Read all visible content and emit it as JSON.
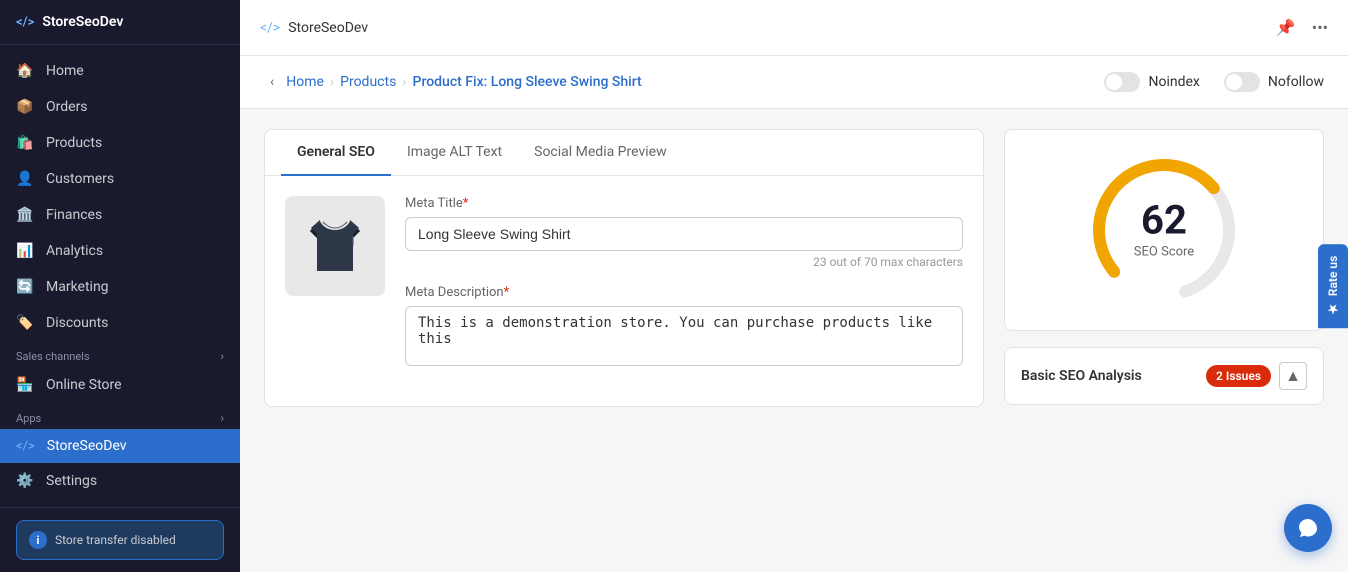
{
  "sidebar": {
    "app_name": "StoreSeoDev",
    "code_icon": "</>",
    "nav_items": [
      {
        "id": "home",
        "label": "Home",
        "icon": "🏠"
      },
      {
        "id": "orders",
        "label": "Orders",
        "icon": "📦"
      },
      {
        "id": "products",
        "label": "Products",
        "icon": "🛍️"
      },
      {
        "id": "customers",
        "label": "Customers",
        "icon": "👤"
      },
      {
        "id": "finances",
        "label": "Finances",
        "icon": "🏛️"
      },
      {
        "id": "analytics",
        "label": "Analytics",
        "icon": "📊"
      },
      {
        "id": "marketing",
        "label": "Marketing",
        "icon": "🔄"
      },
      {
        "id": "discounts",
        "label": "Discounts",
        "icon": "🏷️"
      }
    ],
    "sales_channels_label": "Sales channels",
    "online_store_label": "Online Store",
    "apps_label": "Apps",
    "active_app": "StoreSeoDev",
    "settings_label": "Settings",
    "store_transfer_label": "Store transfer disabled"
  },
  "topbar": {
    "app_name": "StoreSeoDev"
  },
  "breadcrumb": {
    "back_label": "‹",
    "home": "Home",
    "products": "Products",
    "current": "Product Fix: Long Sleeve Swing Shirt",
    "noindex_label": "Noindex",
    "nofollow_label": "Nofollow"
  },
  "tabs": [
    {
      "id": "general",
      "label": "General SEO",
      "active": true
    },
    {
      "id": "alt_text",
      "label": "Image ALT Text",
      "active": false
    },
    {
      "id": "social",
      "label": "Social Media Preview",
      "active": false
    }
  ],
  "form": {
    "meta_title_label": "Meta Title",
    "meta_title_required": "*",
    "meta_title_value": "Long Sleeve Swing Shirt",
    "meta_title_hint": "23 out of 70 max characters",
    "meta_description_label": "Meta Description",
    "meta_description_required": "*",
    "meta_description_value": "This is a demonstration store. You can purchase products like this"
  },
  "seo_score": {
    "score": "62",
    "label": "SEO Score",
    "circle_color": "#f0a500",
    "bg_color": "#e8e8e8",
    "percentage": 62
  },
  "seo_analysis": {
    "label": "Basic SEO Analysis",
    "issues_count": "2 Issues"
  },
  "rate_us": {
    "label": "Rate us",
    "star_icon": "★"
  },
  "chat_button": {
    "label": "chat"
  }
}
